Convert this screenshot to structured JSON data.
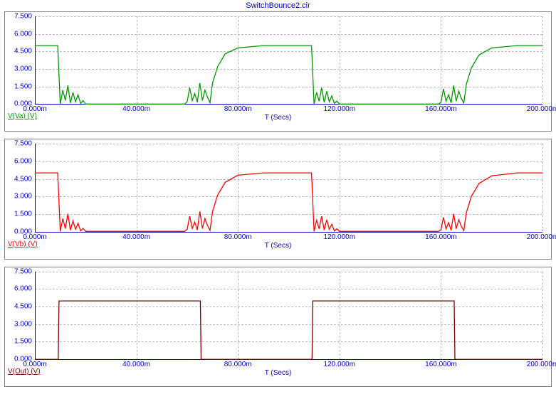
{
  "title": "SwitchBounce2.cir",
  "xlabel": "T (Secs)",
  "x_ticks": [
    "0.000m",
    "40.000m",
    "80.000m",
    "120.000m",
    "160.000m",
    "200.000m"
  ],
  "y_ticks": [
    "0.000",
    "1.500",
    "3.000",
    "4.500",
    "6.000",
    "7.500"
  ],
  "colors": {
    "axis": "#0000cc",
    "grid": "#bcbcbc",
    "panel_border": "#7f7f7f",
    "series": [
      "#009900",
      "#ff0000",
      "#800000"
    ]
  },
  "panels": [
    {
      "series_label": "V(Va) (V)"
    },
    {
      "series_label": "V(Vb) (V)"
    },
    {
      "series_label": "V(Out) (V)"
    }
  ],
  "chart_data": [
    {
      "type": "line",
      "title": "V(Va) (V)",
      "xlabel": "T (Secs)",
      "ylabel": "V(Va) (V)",
      "xlim": [
        0,
        0.2
      ],
      "ylim": [
        0,
        7.5
      ],
      "x": [
        0.0,
        0.009,
        0.01,
        0.011,
        0.012,
        0.013,
        0.014,
        0.015,
        0.016,
        0.017,
        0.018,
        0.019,
        0.02,
        0.03,
        0.059,
        0.06,
        0.061,
        0.062,
        0.063,
        0.064,
        0.065,
        0.066,
        0.067,
        0.068,
        0.069,
        0.07,
        0.072,
        0.075,
        0.08,
        0.09,
        0.1,
        0.109,
        0.11,
        0.111,
        0.112,
        0.113,
        0.114,
        0.115,
        0.116,
        0.117,
        0.118,
        0.119,
        0.12,
        0.13,
        0.159,
        0.16,
        0.161,
        0.162,
        0.163,
        0.164,
        0.165,
        0.166,
        0.167,
        0.168,
        0.169,
        0.17,
        0.172,
        0.175,
        0.18,
        0.19,
        0.2
      ],
      "values": [
        5.0,
        5.0,
        0.0,
        1.2,
        0.3,
        1.6,
        0.1,
        1.0,
        0.2,
        0.8,
        0.05,
        0.3,
        0.0,
        0.0,
        0.0,
        0.2,
        1.4,
        0.3,
        0.9,
        0.15,
        1.8,
        0.3,
        1.2,
        0.6,
        0.1,
        1.8,
        3.2,
        4.3,
        4.8,
        5.0,
        5.0,
        5.0,
        0.0,
        1.0,
        0.25,
        1.4,
        0.15,
        1.1,
        0.2,
        0.7,
        0.05,
        0.25,
        0.0,
        0.0,
        0.0,
        0.15,
        1.3,
        0.25,
        0.8,
        0.1,
        1.6,
        0.25,
        1.1,
        0.5,
        0.08,
        1.7,
        3.1,
        4.2,
        4.8,
        5.0,
        5.0
      ]
    },
    {
      "type": "line",
      "title": "V(Vb) (V)",
      "xlabel": "T (Secs)",
      "ylabel": "V(Vb) (V)",
      "xlim": [
        0,
        0.2
      ],
      "ylim": [
        0,
        7.5
      ],
      "x": [
        0.0,
        0.009,
        0.01,
        0.011,
        0.012,
        0.013,
        0.014,
        0.015,
        0.016,
        0.017,
        0.018,
        0.019,
        0.02,
        0.03,
        0.059,
        0.06,
        0.061,
        0.062,
        0.063,
        0.064,
        0.065,
        0.066,
        0.067,
        0.068,
        0.069,
        0.07,
        0.072,
        0.075,
        0.08,
        0.09,
        0.1,
        0.109,
        0.11,
        0.111,
        0.112,
        0.113,
        0.114,
        0.115,
        0.116,
        0.117,
        0.118,
        0.119,
        0.12,
        0.13,
        0.159,
        0.16,
        0.161,
        0.162,
        0.163,
        0.164,
        0.165,
        0.166,
        0.167,
        0.168,
        0.169,
        0.17,
        0.172,
        0.175,
        0.18,
        0.19,
        0.2
      ],
      "values": [
        5.0,
        5.0,
        0.0,
        1.1,
        0.25,
        1.5,
        0.1,
        0.9,
        0.18,
        0.7,
        0.04,
        0.25,
        0.0,
        0.0,
        0.0,
        0.18,
        1.3,
        0.25,
        0.8,
        0.12,
        1.7,
        0.25,
        1.1,
        0.5,
        0.08,
        1.7,
        3.1,
        4.2,
        4.8,
        5.0,
        5.0,
        5.0,
        0.0,
        0.95,
        0.22,
        1.3,
        0.12,
        1.0,
        0.18,
        0.6,
        0.04,
        0.22,
        0.0,
        0.0,
        0.0,
        0.14,
        1.2,
        0.22,
        0.75,
        0.09,
        1.5,
        0.22,
        1.0,
        0.45,
        0.07,
        1.6,
        3.0,
        4.1,
        4.75,
        5.0,
        5.0
      ]
    },
    {
      "type": "line",
      "title": "V(Out) (V)",
      "xlabel": "T (Secs)",
      "ylabel": "V(Out) (V)",
      "xlim": [
        0,
        0.2
      ],
      "ylim": [
        0,
        7.5
      ],
      "x": [
        0.0,
        0.009,
        0.0092,
        0.0095,
        0.065,
        0.0652,
        0.0655,
        0.109,
        0.1092,
        0.1095,
        0.165,
        0.1652,
        0.1655,
        0.2
      ],
      "values": [
        0.0,
        0.0,
        0.0,
        5.0,
        5.0,
        5.0,
        0.0,
        0.0,
        0.0,
        5.0,
        5.0,
        5.0,
        0.0,
        0.0
      ]
    }
  ]
}
